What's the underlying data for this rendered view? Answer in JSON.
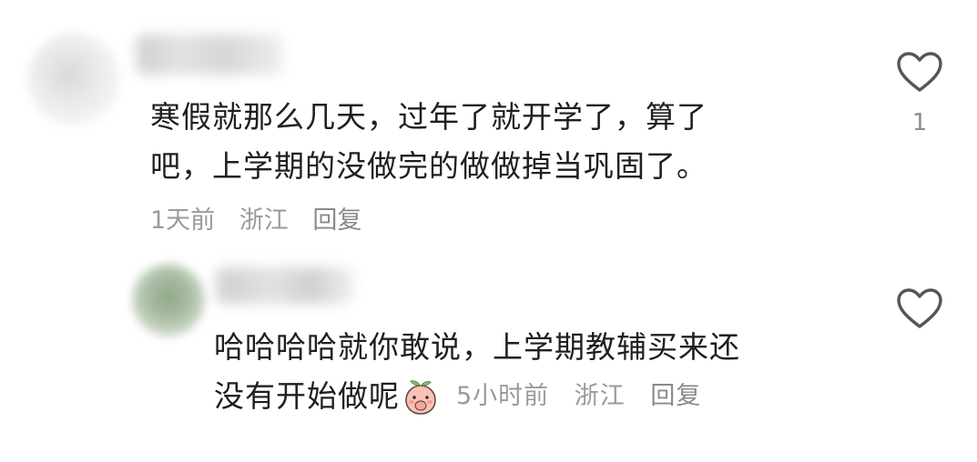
{
  "comments": [
    {
      "text_lines": [
        "寒假就那么几天，过年了就开学了，算了",
        "吧，上学期的没做完的做做掉当巩固了。"
      ],
      "time": "1天前",
      "location": "浙江",
      "reply_label": "回复",
      "like_count": "1"
    },
    {
      "text_lines": [
        "哈哈哈哈就你敢说，上学期教辅买来还",
        "没有开始做呢"
      ],
      "time": "5小时前",
      "location": "浙江",
      "reply_label": "回复",
      "like_count": "",
      "emoji": "peach-covering-mouth-emoji"
    }
  ],
  "colors": {
    "text": "#1f1f1f",
    "meta": "#9a9a9a",
    "icon": "#555555"
  }
}
